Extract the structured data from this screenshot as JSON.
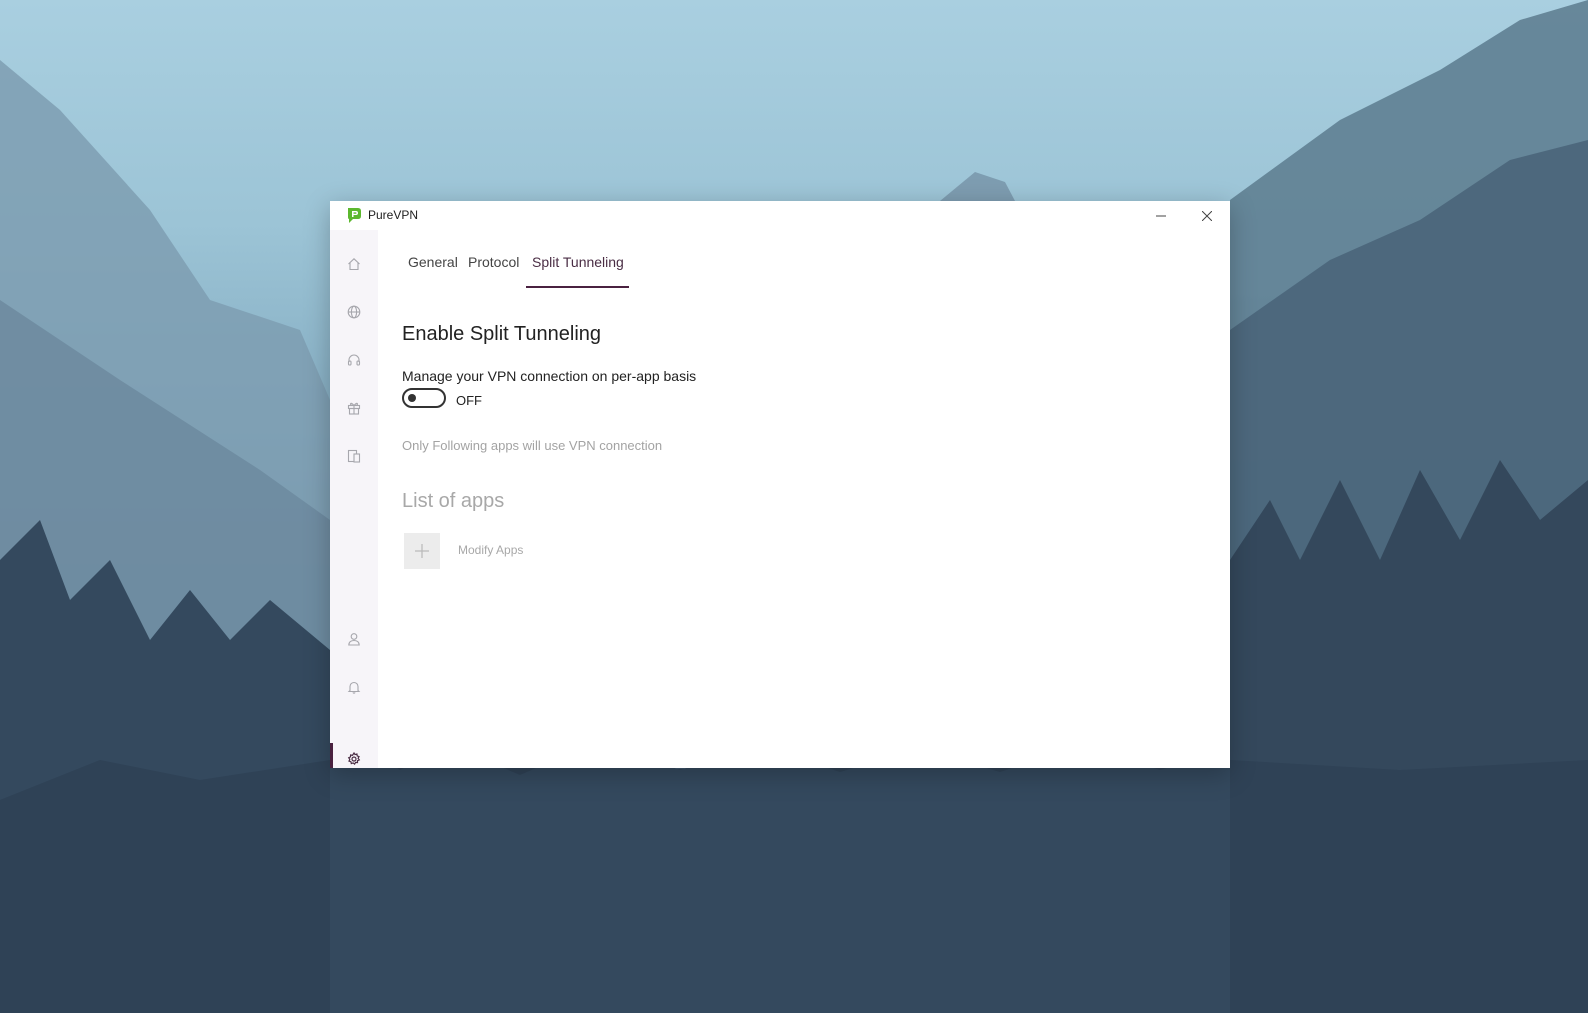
{
  "window": {
    "title": "PureVPN",
    "minimize_icon": "minimize-icon",
    "close_icon": "close-icon"
  },
  "sidebar": {
    "items": [
      {
        "icon": "home-icon"
      },
      {
        "icon": "globe-icon"
      },
      {
        "icon": "headset-icon"
      },
      {
        "icon": "gift-icon"
      },
      {
        "icon": "devices-icon"
      },
      {
        "icon": "user-icon"
      },
      {
        "icon": "bell-icon"
      },
      {
        "icon": "gear-icon",
        "active": true
      }
    ]
  },
  "tabs": [
    {
      "label": "General"
    },
    {
      "label": "Protocol"
    },
    {
      "label": "Split Tunneling",
      "active": true
    }
  ],
  "split_tunneling": {
    "title": "Enable Split Tunneling",
    "description": "Manage your VPN connection on per-app basis",
    "toggle_state": "OFF",
    "note": "Only Following apps will use VPN connection",
    "list_title": "List of apps",
    "modify_label": "Modify Apps"
  },
  "colors": {
    "accent": "#4a2140",
    "logo_green": "#5cb82e"
  }
}
